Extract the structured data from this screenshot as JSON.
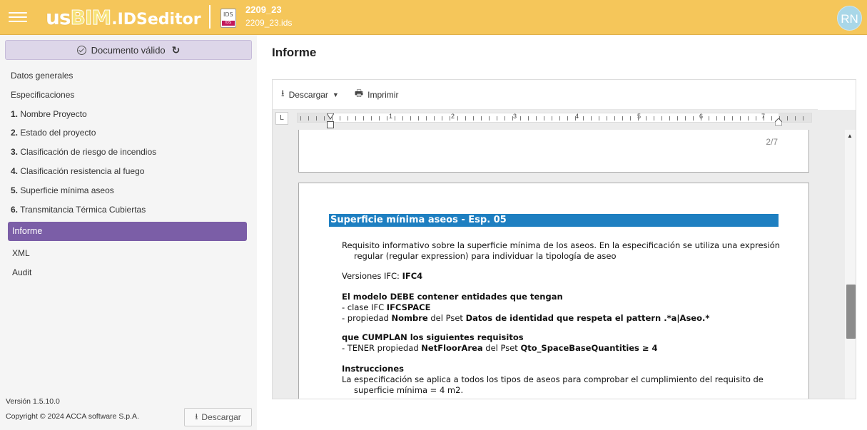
{
  "header": {
    "logo_us": "us",
    "logo_bim": "BIM",
    "logo_ids": ".IDSeditor",
    "file_icon_label": "IDS",
    "file_icon_tag": "IDS",
    "file_title": "2209_23",
    "file_name": "2209_23.ids",
    "avatar": "RN",
    "accent_color": "#f5c65a"
  },
  "sidebar": {
    "valid_label": "Documento válido",
    "items": [
      {
        "num": "",
        "label": "Datos generales"
      },
      {
        "num": "",
        "label": "Especificaciones"
      },
      {
        "num": "1.",
        "label": "Nombre Proyecto"
      },
      {
        "num": "2.",
        "label": "Estado del proyecto"
      },
      {
        "num": "3.",
        "label": "Clasificación de riesgo de incendios"
      },
      {
        "num": "4.",
        "label": "Clasificación resistencia al fuego"
      },
      {
        "num": "5.",
        "label": "Superficie mínima aseos"
      },
      {
        "num": "6.",
        "label": "Transmitancia Térmica Cubiertas"
      }
    ],
    "active_item": "Informe",
    "sub_items": [
      "XML",
      "Audit"
    ],
    "version": "Versión 1.5.10.0",
    "copyright": "Copyright © 2024 ACCA software S.p.A.",
    "download_label": "Descargar",
    "active_color": "#7b5ea7"
  },
  "main": {
    "title": "Informe",
    "toolbar": {
      "download_label": "Descargar",
      "print_label": "Imprimir"
    },
    "ruler_numbers": [
      "1",
      "2",
      "3",
      "4",
      "5",
      "6",
      "7"
    ],
    "page1_number": "2/7",
    "section_title": "Superficie mínima aseos - Esp. 05",
    "section_color": "#1e7fc1",
    "desc_line1": "Requisito informativo sobre la superficie mínima de los aseos. En la especificación se utiliza una expresión",
    "desc_line2": "regular (regular expression) para individuar la tipología de aseo",
    "ifc_label": "Versiones IFC: ",
    "ifc_value": "IFC4",
    "must_heading": "El modelo DEBE contener entidades que tengan",
    "class_prefix": "-  clase IFC ",
    "class_value": "IFCSPACE",
    "prop_prefix": "-  propiedad ",
    "prop_name": "Nombre",
    "prop_mid": " del Pset ",
    "prop_pset": "Datos de identidad que respeta el pattern .*a|Aseo.*",
    "comply_heading": "que CUMPLAN los siguientes requisitos",
    "req_prefix": "-  TENER propiedad ",
    "req_name": "NetFloorArea",
    "req_mid": " del Pset ",
    "req_pset": "Qto_SpaceBaseQuantities ≥ 4",
    "instr_heading": "Instrucciones",
    "instr_line1": "La especificación se aplica a todos los tipos de aseos para comprobar el cumplimiento del requisito de",
    "instr_line2": "superficie mínima = 4 m2."
  }
}
